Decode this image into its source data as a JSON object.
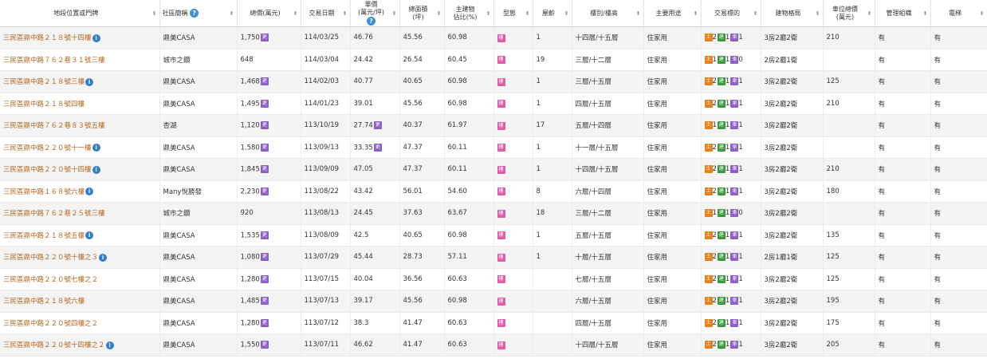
{
  "headers": [
    "地段位置或門牌",
    "社區簡稱",
    "總價(萬元)",
    "交易日期",
    "單價\n(萬元/坪)",
    "總面積\n(坪)",
    "主建物\n佔比(%)",
    "型態",
    "屋齡",
    "樓別/樓高",
    "主要用途",
    "交易標的",
    "建物格局",
    "車位總價\n(萬元)",
    "管理組織",
    "電梯"
  ],
  "icons": {
    "info": "i",
    "note": "更",
    "tag": "樓",
    "land": "土",
    "bldg": "建",
    "park": "車",
    "help": "?"
  },
  "rows": [
    {
      "addr": "三民區鼎中路２１８號十四樓",
      "info": true,
      "community": "鼎美CASA",
      "price": "1,750",
      "price_note": true,
      "date": "114/03/25",
      "unit": "46.76",
      "unit_note": false,
      "area": "45.56",
      "main": "60.98",
      "age": "1",
      "floor": "十四層/十五層",
      "use": "住家用",
      "land": "2",
      "bldg": "1",
      "park": "1",
      "layout": "3房2廳2衛",
      "parking": "210",
      "mgmt": "有",
      "elevator": "有"
    },
    {
      "addr": "三民區鼎中路７６２巷３１號三樓",
      "info": false,
      "community": "城市之鑽",
      "price": "648",
      "price_note": false,
      "date": "114/03/04",
      "unit": "24.42",
      "unit_note": false,
      "area": "26.54",
      "main": "60.45",
      "age": "19",
      "floor": "三層/十二層",
      "use": "住家用",
      "land": "1",
      "bldg": "1",
      "park": "0",
      "layout": "2房2廳1衛",
      "parking": "",
      "mgmt": "有",
      "elevator": "有"
    },
    {
      "addr": "三民區鼎中路２１８號三樓",
      "info": true,
      "community": "鼎美CASA",
      "price": "1,468",
      "price_note": true,
      "date": "114/02/03",
      "unit": "40.77",
      "unit_note": false,
      "area": "40.65",
      "main": "60.98",
      "age": "1",
      "floor": "三層/十五層",
      "use": "住家用",
      "land": "2",
      "bldg": "1",
      "park": "1",
      "layout": "3房2廳2衛",
      "parking": "125",
      "mgmt": "有",
      "elevator": "有"
    },
    {
      "addr": "三民區鼎中路２１８號四樓",
      "info": false,
      "community": "鼎美CASA",
      "price": "1,495",
      "price_note": true,
      "date": "114/01/23",
      "unit": "39.01",
      "unit_note": false,
      "area": "45.56",
      "main": "60.98",
      "age": "1",
      "floor": "四層/十五層",
      "use": "住家用",
      "land": "2",
      "bldg": "1",
      "park": "1",
      "layout": "3房2廳2衛",
      "parking": "210",
      "mgmt": "有",
      "elevator": "有"
    },
    {
      "addr": "三民區鼎中路７６２巷８３號五樓",
      "info": false,
      "community": "杏湖",
      "price": "1,120",
      "price_note": true,
      "date": "113/10/19",
      "unit": "27.74",
      "unit_note": true,
      "area": "40.37",
      "main": "61.97",
      "age": "17",
      "floor": "五層/十四層",
      "use": "住家用",
      "land": "1",
      "bldg": "1",
      "park": "1",
      "layout": "3房2廳2衛",
      "parking": "",
      "mgmt": "有",
      "elevator": "有"
    },
    {
      "addr": "三民區鼎中路２２０號十一樓",
      "info": true,
      "community": "鼎美CASA",
      "price": "1,580",
      "price_note": true,
      "date": "113/09/13",
      "unit": "33.35",
      "unit_note": true,
      "area": "47.37",
      "main": "60.11",
      "age": "1",
      "floor": "十一層/十五層",
      "use": "住家用",
      "land": "2",
      "bldg": "1",
      "park": "1",
      "layout": "3房2廳2衛",
      "parking": "",
      "mgmt": "有",
      "elevator": "有"
    },
    {
      "addr": "三民區鼎中路２２０號十四樓",
      "info": true,
      "community": "鼎美CASA",
      "price": "1,845",
      "price_note": true,
      "date": "113/09/09",
      "unit": "47.05",
      "unit_note": false,
      "area": "47.37",
      "main": "60.11",
      "age": "1",
      "floor": "十四層/十五層",
      "use": "住家用",
      "land": "2",
      "bldg": "1",
      "park": "1",
      "layout": "3房2廳2衛",
      "parking": "210",
      "mgmt": "有",
      "elevator": "有"
    },
    {
      "addr": "三民區鼎中路１６８號六樓",
      "info": true,
      "community": "Many悅勝發",
      "price": "2,230",
      "price_note": true,
      "date": "113/08/22",
      "unit": "43.42",
      "unit_note": false,
      "area": "56.01",
      "main": "54.60",
      "age": "8",
      "floor": "六層/十四層",
      "use": "住家用",
      "land": "2",
      "bldg": "1",
      "park": "1",
      "layout": "3房2廳2衛",
      "parking": "180",
      "mgmt": "有",
      "elevator": "有"
    },
    {
      "addr": "三民區鼎中路７６２巷２５號三樓",
      "info": false,
      "community": "城市之鑽",
      "price": "920",
      "price_note": false,
      "date": "113/08/13",
      "unit": "24.45",
      "unit_note": false,
      "area": "37.63",
      "main": "63.67",
      "age": "18",
      "floor": "三層/十二層",
      "use": "住家用",
      "land": "1",
      "bldg": "1",
      "park": "0",
      "layout": "3房2廳2衛",
      "parking": "",
      "mgmt": "有",
      "elevator": "有"
    },
    {
      "addr": "三民區鼎中路２１８號五樓",
      "info": true,
      "community": "鼎美CASA",
      "price": "1,535",
      "price_note": true,
      "date": "113/08/09",
      "unit": "42.5",
      "unit_note": false,
      "area": "40.65",
      "main": "60.98",
      "age": "1",
      "floor": "五層/十五層",
      "use": "住家用",
      "land": "2",
      "bldg": "1",
      "park": "1",
      "layout": "3房2廳2衛",
      "parking": "135",
      "mgmt": "有",
      "elevator": "有"
    },
    {
      "addr": "三民區鼎中路２２０號十樓之３",
      "info": true,
      "community": "鼎美CASA",
      "price": "1,080",
      "price_note": true,
      "date": "113/07/29",
      "unit": "45.44",
      "unit_note": false,
      "area": "28.73",
      "main": "57.11",
      "age": "1",
      "floor": "十層/十五層",
      "use": "住家用",
      "land": "2",
      "bldg": "1",
      "park": "1",
      "layout": "2房1廳1衛",
      "parking": "125",
      "mgmt": "有",
      "elevator": "有"
    },
    {
      "addr": "三民區鼎中路２２０號七樓之２",
      "info": false,
      "community": "鼎美CASA",
      "price": "1,280",
      "price_note": true,
      "date": "113/07/15",
      "unit": "40.04",
      "unit_note": false,
      "area": "36.56",
      "main": "60.63",
      "age": "",
      "floor": "七層/十五層",
      "use": "住家用",
      "land": "2",
      "bldg": "1",
      "park": "1",
      "layout": "3房2廳2衛",
      "parking": "125",
      "mgmt": "有",
      "elevator": "有"
    },
    {
      "addr": "三民區鼎中路２１８號六樓",
      "info": false,
      "community": "鼎美CASA",
      "price": "1,485",
      "price_note": true,
      "date": "113/07/13",
      "unit": "39.17",
      "unit_note": false,
      "area": "45.56",
      "main": "60.98",
      "age": "",
      "floor": "六層/十五層",
      "use": "住家用",
      "land": "2",
      "bldg": "1",
      "park": "1",
      "layout": "3房2廳2衛",
      "parking": "195",
      "mgmt": "有",
      "elevator": "有"
    },
    {
      "addr": "三民區鼎中路２２０號四樓之２",
      "info": false,
      "community": "鼎美CASA",
      "price": "1,280",
      "price_note": true,
      "date": "113/07/12",
      "unit": "38.3",
      "unit_note": false,
      "area": "41.47",
      "main": "60.63",
      "age": "",
      "floor": "四層/十五層",
      "use": "住家用",
      "land": "2",
      "bldg": "1",
      "park": "1",
      "layout": "3房2廳2衛",
      "parking": "175",
      "mgmt": "有",
      "elevator": "有"
    },
    {
      "addr": "三民區鼎中路２２０號十四樓之２",
      "info": true,
      "community": "鼎美CASA",
      "price": "1,550",
      "price_note": true,
      "date": "113/07/11",
      "unit": "46.62",
      "unit_note": false,
      "area": "41.47",
      "main": "60.63",
      "age": "",
      "floor": "十四層/十五層",
      "use": "住家用",
      "land": "2",
      "bldg": "1",
      "park": "1",
      "layout": "3房2廳2衛",
      "parking": "205",
      "mgmt": "有",
      "elevator": "有"
    }
  ]
}
